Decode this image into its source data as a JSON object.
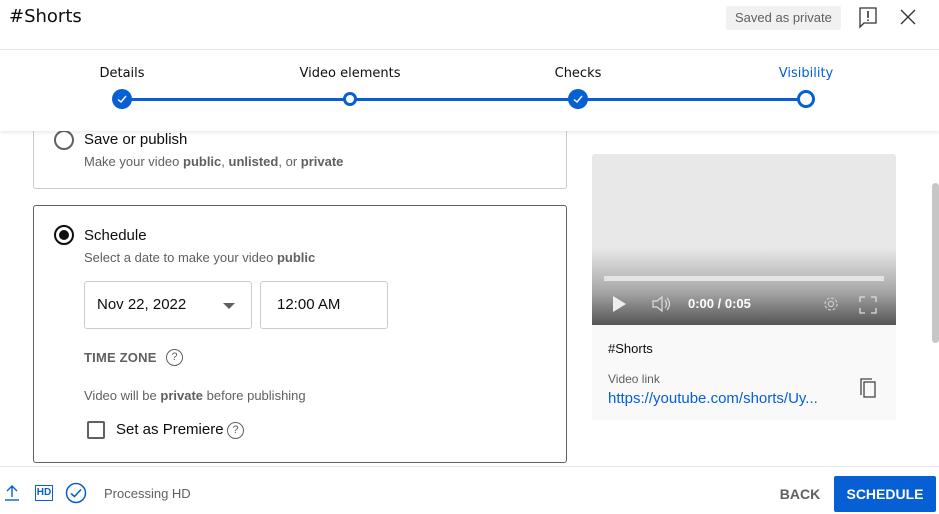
{
  "header": {
    "title": "#Shorts",
    "saved_status": "Saved as private"
  },
  "stepper": {
    "steps": [
      {
        "label": "Details",
        "state": "done"
      },
      {
        "label": "Video elements",
        "state": "open"
      },
      {
        "label": "Checks",
        "state": "done"
      },
      {
        "label": "Visibility",
        "state": "current"
      }
    ]
  },
  "options": {
    "publish": {
      "title": "Save or publish",
      "desc_prefix": "Make your video ",
      "desc_b1": "public",
      "desc_sep1": ", ",
      "desc_b2": "unlisted",
      "desc_sep2": ", or ",
      "desc_b3": "private",
      "selected": false
    },
    "schedule": {
      "title": "Schedule",
      "desc_prefix": "Select a date to make your video ",
      "desc_bold": "public",
      "selected": true,
      "date": "Nov 22, 2022",
      "time": "12:00 AM",
      "timezone_label": "TIME ZONE",
      "help_glyph": "?",
      "private_note_prefix": "Video will be ",
      "private_note_bold": "private",
      "private_note_suffix": " before publishing",
      "premiere_label": "Set as Premiere",
      "premiere_checked": false
    }
  },
  "preview": {
    "time": "0:00 / 0:05",
    "video_title": "#Shorts",
    "link_label": "Video link",
    "link_url": "https://youtube.com/shorts/Uy..."
  },
  "footer": {
    "hd_label": "HD",
    "status": "Processing HD",
    "back_label": "BACK",
    "schedule_label": "SCHEDULE"
  },
  "colors": {
    "accent": "#065fd4",
    "secondary_text": "#606060"
  }
}
